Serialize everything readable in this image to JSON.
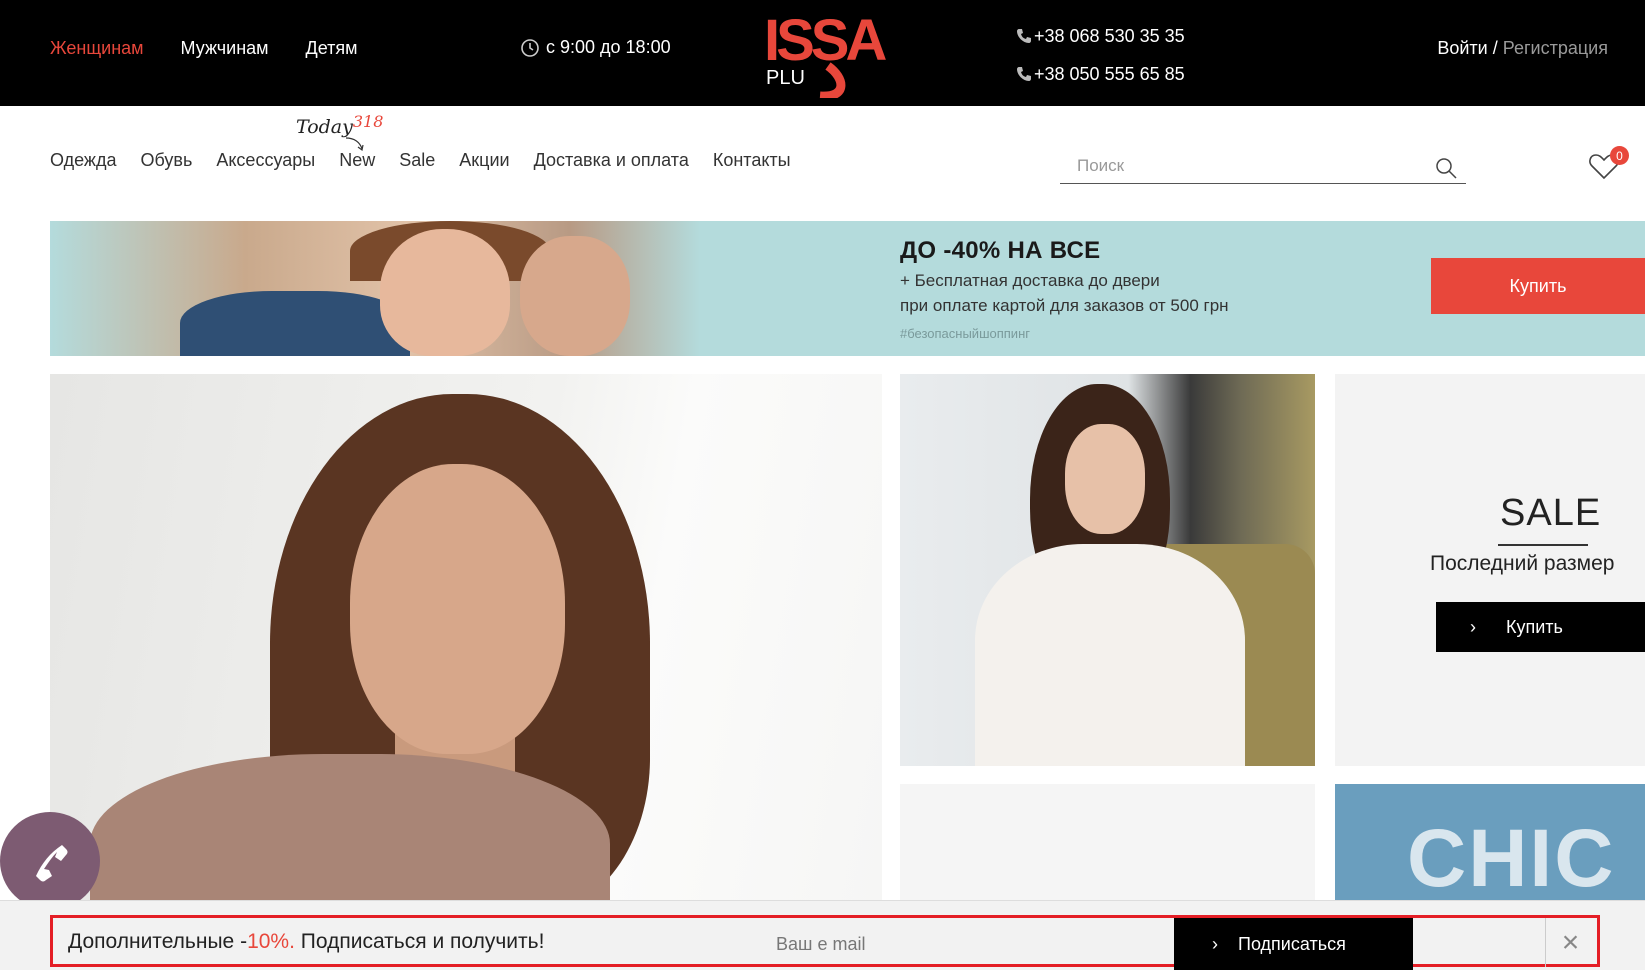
{
  "header": {
    "gender_nav": [
      {
        "label": "Женщинам",
        "active": true
      },
      {
        "label": "Мужчинам",
        "active": false
      },
      {
        "label": "Детям",
        "active": false
      }
    ],
    "hours": "с 9:00 до 18:00",
    "logo": {
      "text_main": "ISSA",
      "text_sub": "PLU"
    },
    "phones": [
      "+38 068 530 35 35",
      "+38 050 555 65 85"
    ],
    "login": "Войти",
    "separator": "/",
    "register": "Регистрация"
  },
  "nav": {
    "items": [
      "Одежда",
      "Обувь",
      "Аксессуары",
      "New",
      "Sale",
      "Акции",
      "Доставка и оплата",
      "Контакты"
    ],
    "today_label": "Today",
    "today_count": "318"
  },
  "search": {
    "placeholder": "Поиск",
    "value": ""
  },
  "wishlist": {
    "count": "0"
  },
  "promo": {
    "title": "ДО -40% НА ВСЕ",
    "line1": "+ Бесплатная доставка до двери",
    "line2": "при оплате картой для заказов от 500 грн",
    "tag": "#безопасныйшоппинг",
    "button": "Купить"
  },
  "sale_card": {
    "title": "SALE",
    "subtitle": "Последний размер",
    "button": "Купить"
  },
  "card5": {
    "text": "CHIC"
  },
  "subscribe": {
    "text_before": "Дополнительные -",
    "percent": "10%.",
    "text_after": " Подписаться и получить!",
    "email_placeholder": "Ваш e mail",
    "button": "Подписаться"
  },
  "colors": {
    "accent": "#e8473b",
    "highlight_border": "#e41e26",
    "callback": "#7d5b72",
    "promo_bg": "#b4dbdc"
  }
}
